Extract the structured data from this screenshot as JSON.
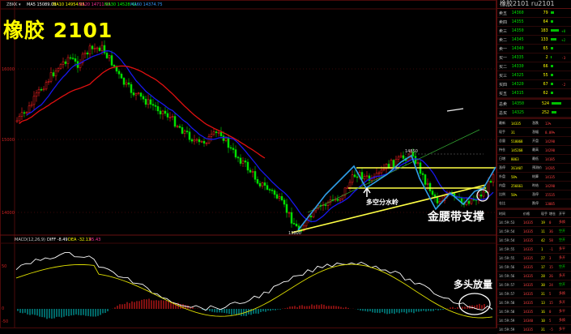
{
  "title": "橡胶 2101",
  "header": {
    "label": "ZBKK ▾",
    "ma_items": [
      {
        "text": "MA5 15089.03",
        "color": "#ffffff"
      },
      {
        "text": "MA10 14954.95",
        "color": "#ffff00"
      },
      {
        "text": "MA20 14711.95",
        "color": "#ff3399"
      },
      {
        "text": "MA30 14528.42",
        "color": "#00ff00"
      },
      {
        "text": "MA60 14374.75",
        "color": "#3399ff"
      }
    ]
  },
  "price_axis": {
    "labels": [
      "16000",
      "15000",
      "14000"
    ]
  },
  "macd": {
    "label": "MACD(12,26,9)",
    "diff": "DIFF -8.49",
    "dea": "DEA -32.13",
    "macd": "45.43",
    "axis_labels": [
      "50",
      "0",
      "-50"
    ]
  },
  "chart_labels": {
    "high": "14850",
    "low": "13800"
  },
  "annotations": {
    "watershed": "多空分水岭",
    "support": "金腰带支撑",
    "volume": "多头放量"
  },
  "colors": {
    "up": "#ff2020",
    "down": "#00e000",
    "support_line": "#ffff44",
    "pattern_line": "#2f9fe8",
    "ma_red": "#e01010",
    "ma_blue": "#1818ee"
  },
  "panel": {
    "title": "橡胶2101  ru2101",
    "orderbook": [
      {
        "label": "卖五",
        "price": "14360",
        "vol": "79",
        "bar": 0.35,
        "chg": ""
      },
      {
        "label": "卖四",
        "price": "14355",
        "vol": "64",
        "bar": 0.3,
        "chg": ""
      },
      {
        "label": "卖三",
        "price": "14350",
        "vol": "183",
        "bar": 0.9,
        "chg": "+8"
      },
      {
        "label": "卖二",
        "price": "14345",
        "vol": "133",
        "bar": 0.65,
        "chg": "+2"
      },
      {
        "label": "卖一",
        "price": "14340",
        "vol": "65",
        "bar": 0.3,
        "chg": ""
      },
      {
        "label": "买一",
        "price": "14335",
        "vol": "2",
        "bar": 0.05,
        "chg": "-3"
      },
      {
        "label": "买二",
        "price": "14330",
        "vol": "66",
        "bar": 0.3,
        "chg": ""
      },
      {
        "label": "买三",
        "price": "14325",
        "vol": "55",
        "bar": 0.25,
        "chg": ""
      },
      {
        "label": "买四",
        "price": "14320",
        "vol": "67",
        "bar": 0.3,
        "chg": "-2"
      },
      {
        "label": "买五",
        "price": "14315",
        "vol": "62",
        "bar": 0.3,
        "chg": ""
      }
    ],
    "totals": [
      {
        "label": "总卖",
        "price": "14350",
        "vol": "524",
        "bar": 1.0
      },
      {
        "label": "总买",
        "price": "14325",
        "vol": "252",
        "bar": 0.5
      }
    ],
    "stats": [
      {
        "a": "最新",
        "b": "14335",
        "c": "涨跌",
        "d": "13%"
      },
      {
        "a": "现手",
        "b": "31",
        "c": "涨幅",
        "d": "0.09%"
      },
      {
        "a": "总量",
        "b": "518068",
        "c": "开盘",
        "d": "14290"
      },
      {
        "a": "持仓",
        "b": "145268",
        "c": "最高",
        "d": "14290"
      },
      {
        "a": "日增",
        "b": "8063",
        "c": "最低",
        "d": "14185"
      },
      {
        "a": "涨停",
        "b": "261407",
        "c": "预测价",
        "d": "14285"
      },
      {
        "a": "外盘",
        "b": "58%",
        "c": "结算",
        "d": "14135"
      },
      {
        "a": "内盘",
        "b": "256661",
        "c": "昨结",
        "d": "14290"
      },
      {
        "a": "比例",
        "b": "50%",
        "c": "涨停",
        "d": "15535"
      },
      {
        "a": "仓比",
        "b": "",
        "c": "跌停",
        "d": "13085"
      }
    ],
    "ticks_header": [
      "时间",
      "价格",
      "现手",
      "增仓",
      "开平"
    ],
    "ticks": [
      {
        "time": "14:59:53",
        "price": "14335",
        "vol": "19",
        "chg": "0",
        "type": "多换"
      },
      {
        "time": "14:59:54",
        "price": "14335",
        "vol": "11",
        "chg": "36",
        "type": "空开"
      },
      {
        "time": "14:59:54",
        "price": "14335",
        "vol": "42",
        "chg": "58",
        "type": "空开"
      },
      {
        "time": "14:59:55",
        "price": "14335",
        "vol": "1",
        "chg": "-1",
        "type": "多平"
      },
      {
        "time": "14:59:55",
        "price": "14335",
        "vol": "27",
        "chg": "3",
        "type": "多开"
      },
      {
        "time": "14:59:56",
        "price": "14335",
        "vol": "17",
        "chg": "15",
        "type": "空开"
      },
      {
        "time": "14:59:56",
        "price": "14335",
        "vol": "28",
        "chg": "26",
        "type": "多开"
      },
      {
        "time": "14:59:57",
        "price": "14335",
        "vol": "30",
        "chg": "24",
        "type": "空开"
      },
      {
        "time": "14:59:57",
        "price": "14335",
        "vol": "31",
        "chg": "5",
        "type": "多换"
      },
      {
        "time": "14:59:58",
        "price": "14335",
        "vol": "13",
        "chg": "15",
        "type": "多开"
      },
      {
        "time": "14:59:58",
        "price": "14335",
        "vol": "16",
        "chg": "0",
        "type": "多平"
      },
      {
        "time": "14:59:59",
        "price": "14340",
        "vol": "10",
        "chg": "5",
        "type": "多换"
      },
      {
        "time": "14:59:59",
        "price": "14335",
        "vol": "31",
        "chg": "-5",
        "type": "多平"
      }
    ]
  }
}
